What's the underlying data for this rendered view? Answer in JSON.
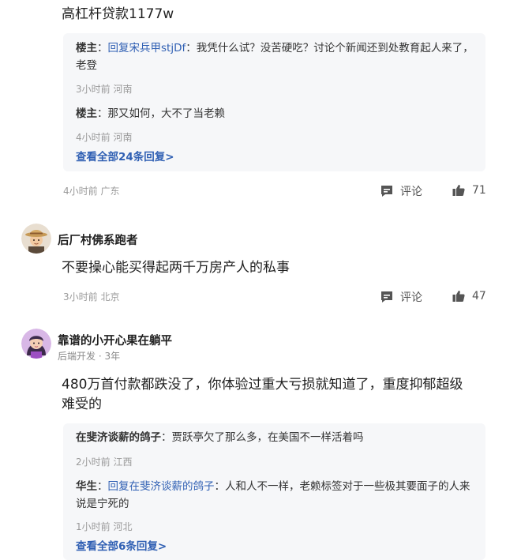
{
  "comment1": {
    "text": "高杠杆贷款1177w",
    "replies": [
      {
        "author": "楼主",
        "separator": "：",
        "link": "回复宋兵甲stjDf",
        "text": "：我凭什么试？没苦硬吃？讨论个新闻还到处教育起人来了，老登",
        "meta": "3小时前 河南"
      },
      {
        "author": "楼主",
        "separator": "：",
        "link": "",
        "text": "那又如何，大不了当老赖",
        "meta": "4小时前 河南"
      }
    ],
    "see_all": "查看全部24条回复>",
    "meta": "4小时前 广东",
    "comment_label": "评论",
    "likes": "71"
  },
  "comment2": {
    "username": "后厂村佛系跑者",
    "text": "不要操心能买得起两千万房产人的私事",
    "meta": "3小时前 北京",
    "comment_label": "评论",
    "likes": "47"
  },
  "comment3": {
    "username": "靠谱的小开心果在躺平",
    "subinfo": "后端开发 · 3年",
    "text_line1": "480万首付款都跌没了，你体验过重大亏损就知道了，重度抑郁超级",
    "text_line2": "难受的",
    "replies": [
      {
        "author": "在斐济谈薪的鸽子",
        "separator": "：",
        "link": "",
        "text": "贾跃亭欠了那么多，在美国不一样活着吗",
        "meta": "2小时前 江西"
      },
      {
        "author": "华生",
        "separator": "：",
        "link": "回复在斐济谈薪的鸽子",
        "text": "：人和人不一样，老赖标签对于一些极其要面子的人来说是宁死的",
        "meta": "1小时前 河北"
      }
    ],
    "see_all": "查看全部6条回复>"
  },
  "icons": {
    "comment": "comment-bubble-icon",
    "like": "thumbs-up-icon",
    "avatar1": "straw-hat-avatar",
    "avatar2": "girl-avatar"
  }
}
